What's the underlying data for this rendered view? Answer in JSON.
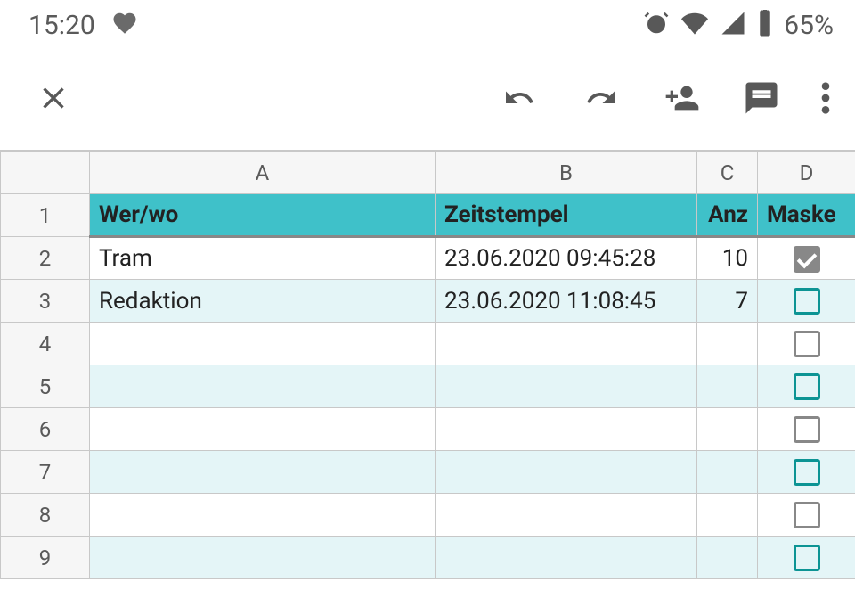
{
  "status": {
    "time": "15:20",
    "battery": "65%"
  },
  "columns": {
    "A": "A",
    "B": "B",
    "C": "C",
    "D": "D"
  },
  "headers": {
    "A": "Wer/wo",
    "B": "Zeitstempel",
    "C": "Anz",
    "D": "Maske"
  },
  "rows": [
    {
      "num": "1"
    },
    {
      "num": "2",
      "A": "Tram",
      "B": "23.06.2020 09:45:28",
      "C": "10",
      "D_checked": true
    },
    {
      "num": "3",
      "A": "Redaktion",
      "B": "23.06.2020 11:08:45",
      "C": "7",
      "D_checked": false
    },
    {
      "num": "4",
      "A": "",
      "B": "",
      "C": "",
      "D_checked": false
    },
    {
      "num": "5",
      "A": "",
      "B": "",
      "C": "",
      "D_checked": false
    },
    {
      "num": "6",
      "A": "",
      "B": "",
      "C": "",
      "D_checked": false
    },
    {
      "num": "7",
      "A": "",
      "B": "",
      "C": "",
      "D_checked": false
    },
    {
      "num": "8",
      "A": "",
      "B": "",
      "C": "",
      "D_checked": false
    },
    {
      "num": "9",
      "A": "",
      "B": "",
      "C": "",
      "D_checked": false
    }
  ]
}
